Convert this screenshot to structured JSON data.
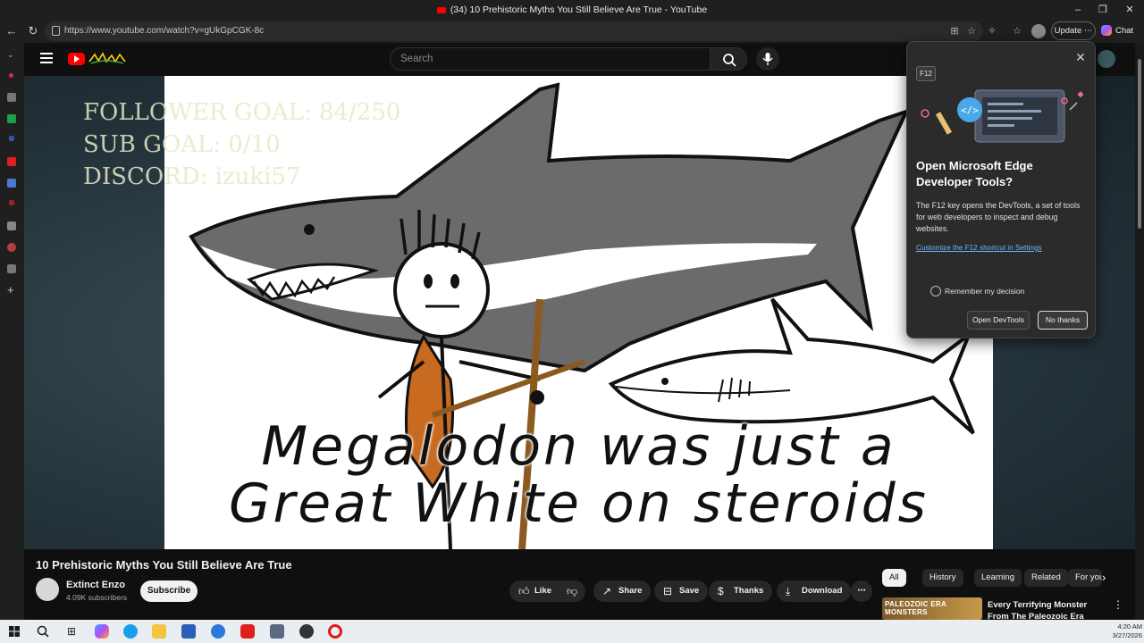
{
  "window": {
    "title": "(34) 10 Prehistoric Myths You Still Believe Are True - YouTube",
    "minimize": "–",
    "restore": "❐",
    "close": "✕"
  },
  "browser": {
    "url": "https://www.youtube.com/watch?v=gUkGpCGK-8c",
    "update_label": "Update",
    "chat_label": "Chat"
  },
  "youtube": {
    "search_placeholder": "Search",
    "video": {
      "overlay_goals": [
        "FOLLOWER GOAL:  84/250",
        "SUB GOAL: 0/10",
        "DISCORD: izuki57"
      ],
      "caption_line1": "Megalodon was just a",
      "caption_line2": "Great White on steroids",
      "title": "10 Prehistoric Myths You Still Believe Are True"
    },
    "channel": {
      "name": "Extinct Enzo",
      "subscribers": "4.09K subscribers",
      "subscribe_label": "Subscribe"
    },
    "actions": {
      "like": "Like",
      "share": "Share",
      "save": "Save",
      "thanks": "Thanks",
      "download": "Download"
    },
    "chips": [
      "All",
      "History",
      "Learning",
      "Related",
      "For you"
    ],
    "recommended": {
      "thumb_text": "PALEOZOIC ERA MONSTERS",
      "title": "Every Terrifying Monster From The Paleozoic Era"
    }
  },
  "devtools_popup": {
    "badge": "F12",
    "title": "Open Microsoft Edge Developer Tools?",
    "body": "The F12 key opens the DevTools, a set of tools for web developers to inspect and debug websites.",
    "link": "Customize the F12 shortcut in Settings",
    "checkbox_label": "Remember my decision",
    "open_button": "Open DevTools",
    "no_button": "No thanks"
  },
  "taskbar": {
    "time": "4:20 AM",
    "date": "3/27/2026"
  }
}
